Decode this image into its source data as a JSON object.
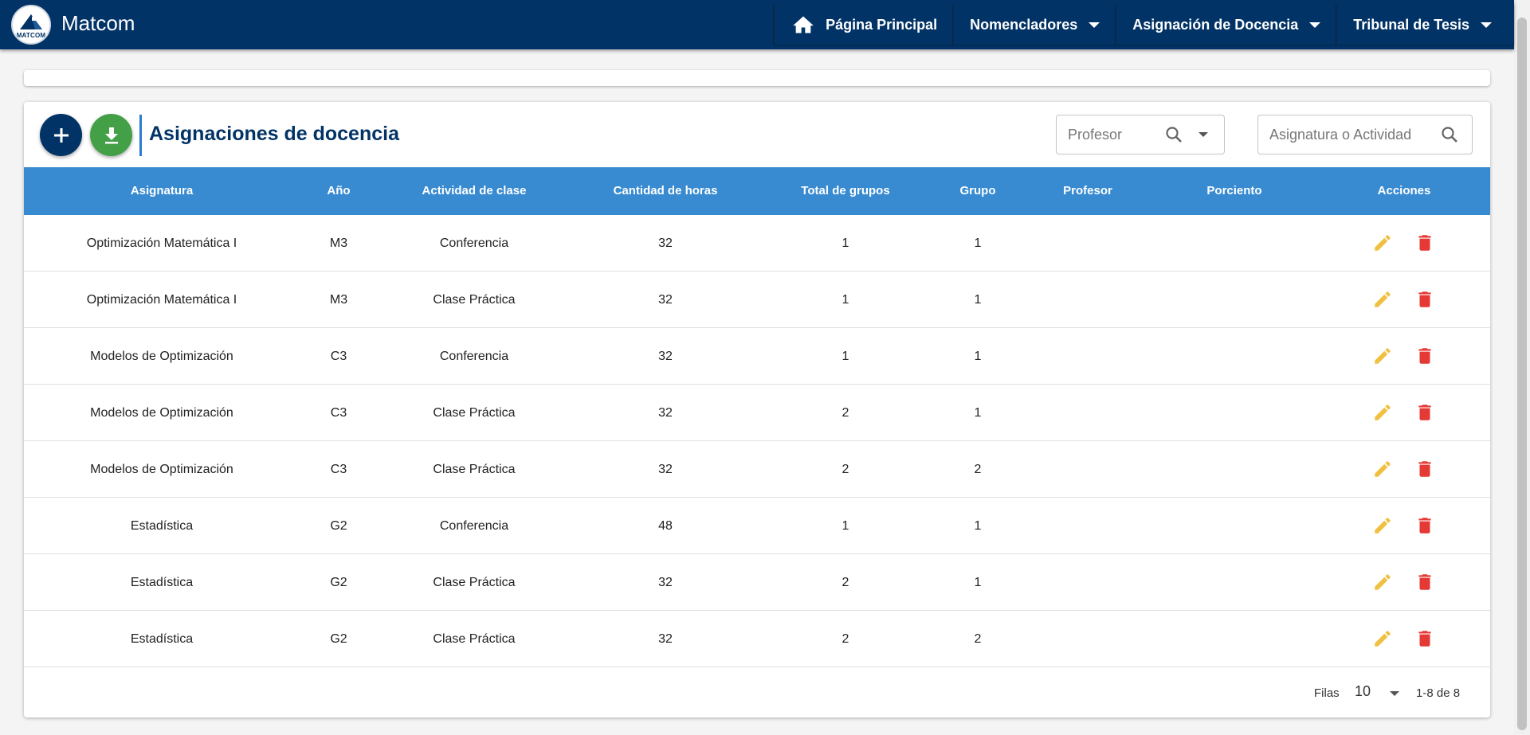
{
  "brand": {
    "logo_text": "MATCOM",
    "name": "Matcom"
  },
  "nav": [
    {
      "label": "Página Principal",
      "icon": "home-icon"
    },
    {
      "label": "Nomencladores"
    },
    {
      "label": "Asignación de Docencia"
    },
    {
      "label": "Tribunal de Tesis"
    }
  ],
  "header": {
    "title": "Asignaciones de docencia",
    "add_icon": "plus-icon",
    "download_icon": "download-icon",
    "profesor_placeholder": "Profesor",
    "asignatura_placeholder": "Asignatura o Actividad"
  },
  "table": {
    "columns": [
      "Asignatura",
      "Año",
      "Actividad de clase",
      "Cantidad de horas",
      "Total de grupos",
      "Grupo",
      "Profesor",
      "Porciento",
      "Acciones"
    ],
    "rows": [
      [
        "Optimización Matemática I",
        "M3",
        "Conferencia",
        "32",
        "1",
        "1",
        "",
        ""
      ],
      [
        "Optimización Matemática I",
        "M3",
        "Clase Práctica",
        "32",
        "1",
        "1",
        "",
        ""
      ],
      [
        "Modelos de Optimización",
        "C3",
        "Conferencia",
        "32",
        "1",
        "1",
        "",
        ""
      ],
      [
        "Modelos de Optimización",
        "C3",
        "Clase Práctica",
        "32",
        "2",
        "1",
        "",
        ""
      ],
      [
        "Modelos de Optimización",
        "C3",
        "Clase Práctica",
        "32",
        "2",
        "2",
        "",
        ""
      ],
      [
        "Estadística",
        "G2",
        "Conferencia",
        "48",
        "1",
        "1",
        "",
        ""
      ],
      [
        "Estadística",
        "G2",
        "Clase Práctica",
        "32",
        "2",
        "1",
        "",
        ""
      ],
      [
        "Estadística",
        "G2",
        "Clase Práctica",
        "32",
        "2",
        "2",
        "",
        ""
      ]
    ],
    "action_icons": [
      "pencil-icon",
      "trash-icon"
    ]
  },
  "pagination": {
    "rows_label": "Filas",
    "rows_per_page": "10",
    "range": "1-8 de 8"
  },
  "colors": {
    "navbar": "#023366",
    "table_header": "#388bd1",
    "add_fab": "#023366",
    "download_fab": "#43a047",
    "edit": "#f0c040",
    "delete": "#e53935"
  }
}
